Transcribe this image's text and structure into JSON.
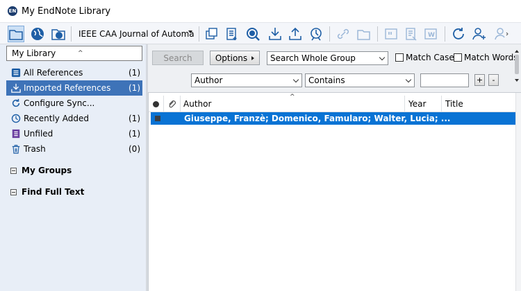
{
  "window": {
    "title": "My EndNote Library",
    "logo_text": "EN"
  },
  "toolbar": {
    "style_select": "IEEE CAA Journal of Automati",
    "buttons": [
      "local-library-mode-icon",
      "online-search-mode-icon",
      "integrated-library-online-mode-icon",
      "copy-formatted-icon",
      "new-reference-icon",
      "online-search-icon",
      "import-icon",
      "export-icon",
      "find-full-text-icon",
      "open-link-icon",
      "open-file-icon",
      "insert-citation-icon",
      "format-bibliography-icon",
      "return-to-word-icon",
      "sync-icon",
      "share-library-icon",
      "manage-users-icon"
    ]
  },
  "sidebar": {
    "library_label": "My Library",
    "groups": [
      {
        "label": "All References",
        "count": "(1)",
        "icon": "all-references-icon"
      },
      {
        "label": "Imported References",
        "count": "(1)",
        "icon": "imported-references-icon",
        "selected": true
      },
      {
        "label": "Configure Sync...",
        "count": "",
        "icon": "sync-icon"
      },
      {
        "label": "Recently Added",
        "count": "(1)",
        "icon": "recently-added-icon"
      },
      {
        "label": "Unfiled",
        "count": "(1)",
        "icon": "unfiled-icon"
      },
      {
        "label": "Trash",
        "count": "(0)",
        "icon": "trash-icon"
      }
    ],
    "sections": [
      {
        "label": "My Groups"
      },
      {
        "label": "Find Full Text"
      }
    ]
  },
  "search": {
    "search_button": "Search",
    "options_button": "Options",
    "scope": "Search Whole Group",
    "match_case": "Match Case",
    "match_words": "Match Words",
    "field": "Author",
    "operator": "Contains",
    "value": "",
    "add_label": "+",
    "remove_label": "-"
  },
  "references": {
    "columns": {
      "author": "Author",
      "year": "Year",
      "title": "Title"
    },
    "rows": [
      {
        "author": "Giuseppe, Franzè; Domenico, Famularo; Walter, Lucia; ...",
        "year": "",
        "title": "",
        "selected": true
      }
    ]
  },
  "colors": {
    "selection": "#0a73d4",
    "sidebar_selected": "#3e73b8",
    "sidebar_bg": "#e8eef7"
  }
}
